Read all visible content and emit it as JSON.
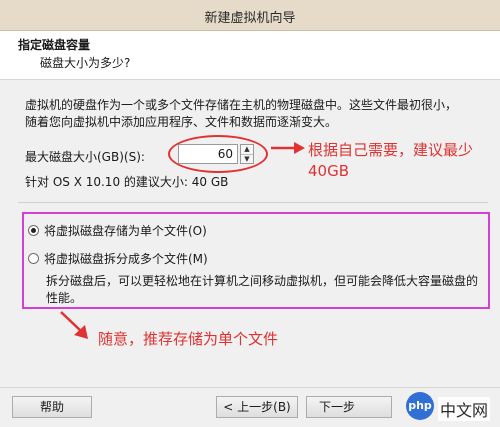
{
  "window": {
    "title": "新建虚拟机向导"
  },
  "header": {
    "title": "指定磁盘容量",
    "subtitle": "磁盘大小为多少?"
  },
  "body": {
    "description": "虚拟机的硬盘作为一个或多个文件存储在主机的物理磁盘中。这些文件最初很小，随着您向虚拟机中添加应用程序、文件和数据而逐渐变大。",
    "max_size_label": "最大磁盘大小(GB)(S):",
    "max_size_value": "60",
    "recommended": "针对 OS X 10.10 的建议大小: 40 GB"
  },
  "options": {
    "single_file": {
      "label": "将虚拟磁盘存储为单个文件(O)",
      "selected": true
    },
    "split_files": {
      "label": "将虚拟磁盘拆分成多个文件(M)",
      "selected": false
    },
    "split_description": "拆分磁盘后，可以更轻松地在计算机之间移动虚拟机，但可能会降低大容量磁盘的性能。"
  },
  "annotations": {
    "size_note": "根据自己需要，建议最少40GB",
    "storage_note": "随意，推荐存储为单个文件",
    "color": "#e03232",
    "box_color": "#d63fd6"
  },
  "footer": {
    "help": "帮助",
    "back": "< 上一步(B)",
    "next": "下一步"
  },
  "watermark": {
    "text": "中文网",
    "logo": "php"
  }
}
